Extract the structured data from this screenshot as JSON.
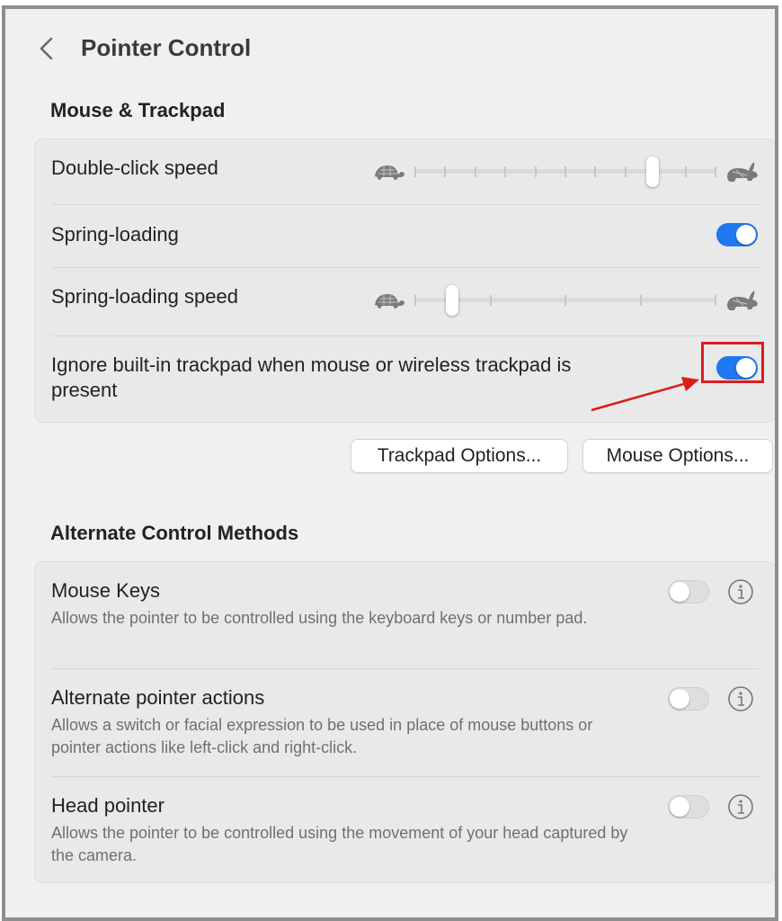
{
  "header": {
    "back_icon": "chevron-left-icon",
    "title": "Pointer Control"
  },
  "mouse_trackpad": {
    "section_title": "Mouse & Trackpad",
    "double_click": {
      "label": "Double-click speed",
      "slow_icon": "turtle-icon",
      "fast_icon": "rabbit-icon",
      "ticks": 11,
      "value_fraction": 0.8
    },
    "spring_loading": {
      "label": "Spring-loading",
      "enabled": true
    },
    "spring_speed": {
      "label": "Spring-loading speed",
      "slow_icon": "turtle-icon",
      "fast_icon": "rabbit-icon",
      "ticks": 5,
      "value_fraction": 0.11
    },
    "ignore_trackpad": {
      "label": "Ignore built-in trackpad when mouse or wireless trackpad is present",
      "enabled": true
    },
    "buttons": {
      "trackpad_options": "Trackpad Options...",
      "mouse_options": "Mouse Options..."
    }
  },
  "alternate": {
    "section_title": "Alternate Control Methods",
    "items": [
      {
        "label": "Mouse Keys",
        "description": "Allows the pointer to be controlled using the keyboard keys or number pad.",
        "enabled": false
      },
      {
        "label": "Alternate pointer actions",
        "description": "Allows a switch or facial expression to be used in place of mouse buttons or pointer actions like left-click and right-click.",
        "enabled": false
      },
      {
        "label": "Head pointer",
        "description": "Allows the pointer to be controlled using the movement of your head captured by the camera.",
        "enabled": false
      }
    ]
  },
  "colors": {
    "accent": "#1f78f0",
    "annotation": "#d91e1e",
    "background": "#f0f0f0",
    "card": "#e9e9e9"
  }
}
